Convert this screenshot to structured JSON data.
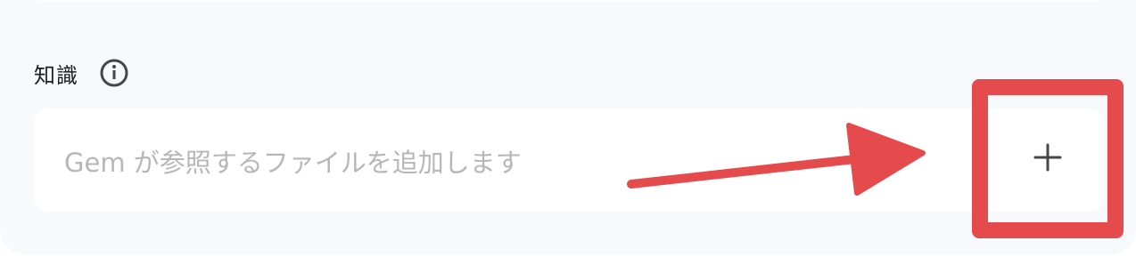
{
  "knowledge": {
    "title": "知識",
    "info_icon": "info-icon",
    "placeholder": "Gem が参照するファイルを追加します",
    "add_icon": "plus-icon"
  },
  "colors": {
    "panel_bg": "#f8f9fd",
    "field_bg": "#ffffff",
    "highlight_red": "#e54a4c",
    "placeholder_text": "#b7b7b7",
    "icon_dark": "#444746"
  }
}
